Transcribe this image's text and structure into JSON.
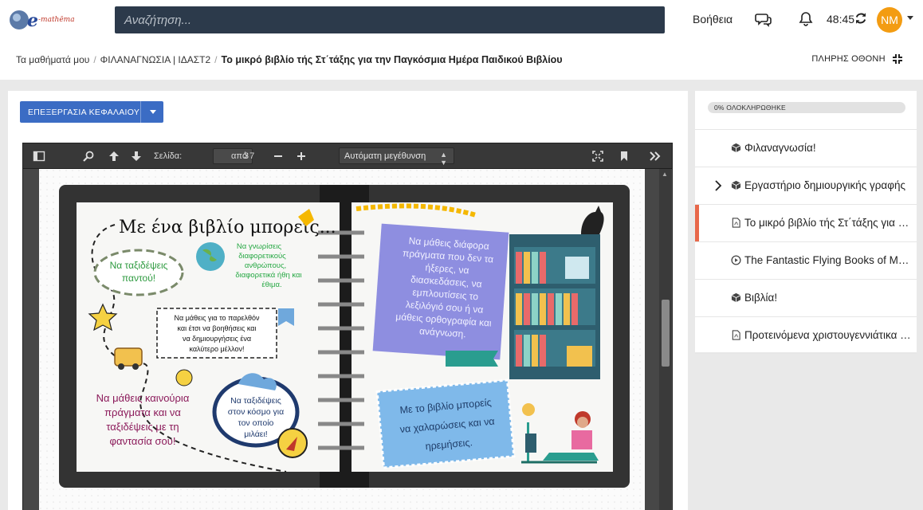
{
  "navbar": {
    "search_placeholder": "Αναζήτηση...",
    "help_label": "Βοήθεια",
    "timer": "48:45",
    "avatar_initials": "NM"
  },
  "breadcrumb": {
    "items": [
      "Τα μαθήματά μου",
      "ΦΙΛΑΝΑΓΝΩΣΙΑ | ΙΔΑΣΤ2"
    ],
    "current": "Το μικρό βιβλίο τής Στ΄τάξης για την Παγκόσμια Ημέρα Παιδικού Βιβλίου",
    "fullscreen_label": "ΠΛΗΡΗΣ ΟΘΟΝΗ"
  },
  "main": {
    "edit_button_label": "ΕΠΕΞΕΡΓΑΣΙΑ ΚΕΦΑΛΑΙΟΥ"
  },
  "pdf_viewer": {
    "page_label": "Σελίδα:",
    "page_value": "3",
    "page_count_label": "από 7",
    "zoom_value": "Αυτόματη μεγέθυνση",
    "slide": {
      "title": "Με ένα βιβλίο μπορείς...",
      "travel_everywhere": "Να ταξιδέψεις παντού!",
      "learn_cultures": "Να γνωρίσεις διαφορετικούς ανθρώπους, διαφορετικά ήθη και έθιμα.",
      "learn_past": "Να μάθεις για το παρελθόν και έτσι να βοηθήσεις και να δημιουργήσεις ένα καλύτερο μέλλον!",
      "learn_new_things": "Να μάθεις καινούρια πράγματα και να ταξιδέψεις με τη φαντασία σου!",
      "travel_world": "Να ταξιδέψεις στον κόσμο για τον οποίο μιλάει!",
      "learn_various": "Να μάθεις διάφορα πράγματα που δεν τα ήξερες, να διασκεδάσεις, να εμπλουτίσεις το λεξιλόγιό σου ή να μάθεις ορθογραφία και ανάγνωση.",
      "relax": "Με το βιβλίο μπορείς να χαλαρώσεις και να ηρεμήσεις."
    }
  },
  "sidebar": {
    "progress_label": "0% ΟΛΟΚΛΗΡΩΘΗΚΕ",
    "progress_value": 0,
    "items": [
      {
        "label": "Φιλαναγνωσία!",
        "icon": "box-icon"
      },
      {
        "label": "Εργαστήριο δημιουργικής γραφής",
        "icon": "box-icon"
      },
      {
        "label": "Το μικρό βιβλίο τής Στ΄τάξης για την Παγκόσμια Ημέρα Παιδικού Βιβλίου",
        "icon": "pdf-file-icon"
      },
      {
        "label": "The Fantastic Flying Books of Mr. Morris Lessmore",
        "icon": "play-circle-icon"
      },
      {
        "label": "Βιβλία!",
        "icon": "box-icon"
      },
      {
        "label": "Προτεινόμενα χριστουγεννιάτικα βιβλία",
        "icon": "pdf-file-icon"
      }
    ]
  },
  "colors": {
    "accent": "#3b6cc4",
    "avatar": "#f39c12",
    "active_marker": "#e8684a",
    "search_bg": "#2c3a4b"
  }
}
